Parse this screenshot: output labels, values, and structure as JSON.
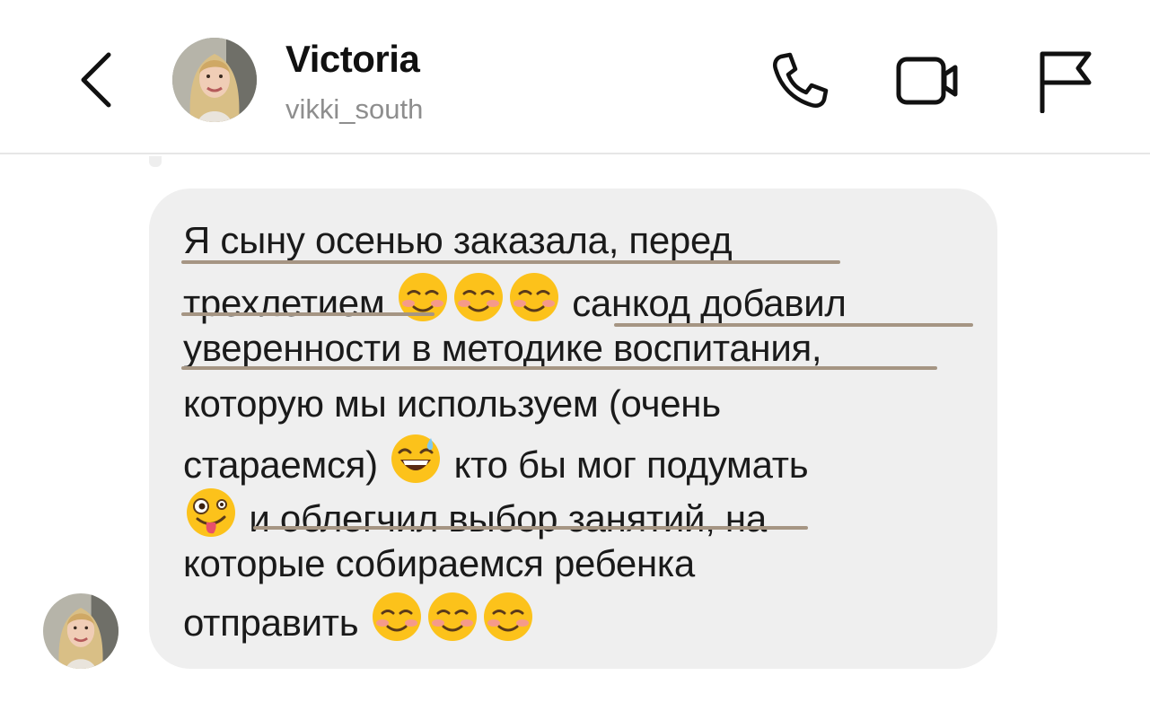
{
  "header": {
    "contact_name": "Victoria",
    "username": "vikki_south",
    "icons": {
      "back": "chevron-left-icon",
      "call": "phone-icon",
      "video": "video-camera-icon",
      "report": "flag-icon"
    }
  },
  "message": {
    "lines": [
      [
        "Я сыну осенью заказала, перед"
      ],
      [
        "трехлетием",
        " санкод добавил"
      ],
      [
        "уверенности в методике воспитания,"
      ],
      [
        "которую мы используем (очень"
      ],
      [
        "стараемся)",
        " кто бы мог подумать"
      ],
      [
        "",
        " и облегчил выбор занятий, на"
      ],
      [
        "которые собираемся ребенка"
      ],
      [
        "отправить"
      ]
    ],
    "emojis": {
      "line2": [
        "smiling-face-icon",
        "smiling-face-icon",
        "smiling-face-icon"
      ],
      "line5": [
        "grinning-sweat-icon"
      ],
      "line6": [
        "zany-face-icon"
      ],
      "line8": [
        "smiling-face-icon",
        "smiling-face-icon",
        "smiling-face-icon"
      ]
    }
  },
  "colors": {
    "bubble": "#efefef",
    "underline": "#a59583",
    "muted_text": "#8e8e8e",
    "divider": "#e6e6e6"
  }
}
